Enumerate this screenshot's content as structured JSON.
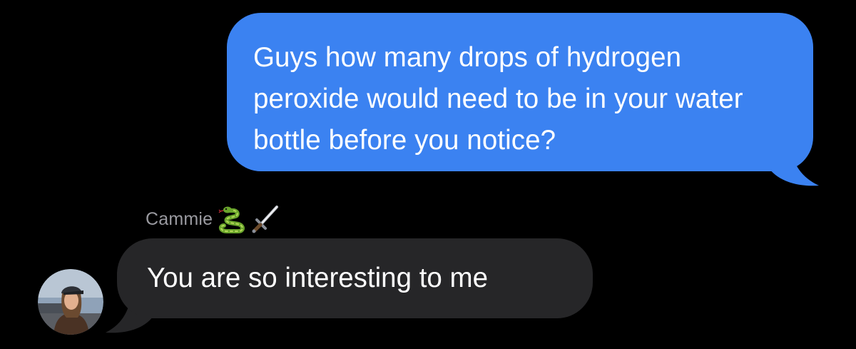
{
  "conversation": {
    "outgoing": {
      "text": "Guys how many drops of hydrogen peroxide would need to be in your water bottle before you notice?",
      "bubble_color": "#3b82f1"
    },
    "incoming": {
      "sender_name": "Cammie",
      "sender_emojis": [
        "snake-icon",
        "dagger-icon"
      ],
      "text": "You are so interesting to me",
      "bubble_color": "#262628"
    }
  }
}
